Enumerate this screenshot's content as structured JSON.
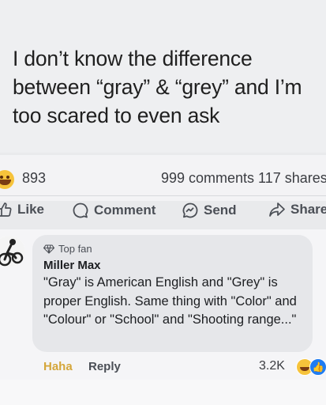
{
  "post": {
    "text": "I don’t know the difference between “gray” & “grey” and I’m too scared to even ask"
  },
  "stats": {
    "reactions": "893",
    "comments_shares": "999 comments  117 shares"
  },
  "actions": {
    "like": "Like",
    "comment": "Comment",
    "send": "Send",
    "share": "Share"
  },
  "comment": {
    "badge": "Top fan",
    "author": "Miller Max",
    "text": "\"Gray\" is American English and \"Grey\" is proper English. Same thing with \"Color\" and \"Colour\" or \"School\" and \"Shooting range...\"",
    "reaction_label": "Haha",
    "reply_label": "Reply",
    "reaction_count": "3.2K"
  },
  "colors": {
    "haha": "#d4a63a",
    "like_blue": "#1f7cf2"
  }
}
